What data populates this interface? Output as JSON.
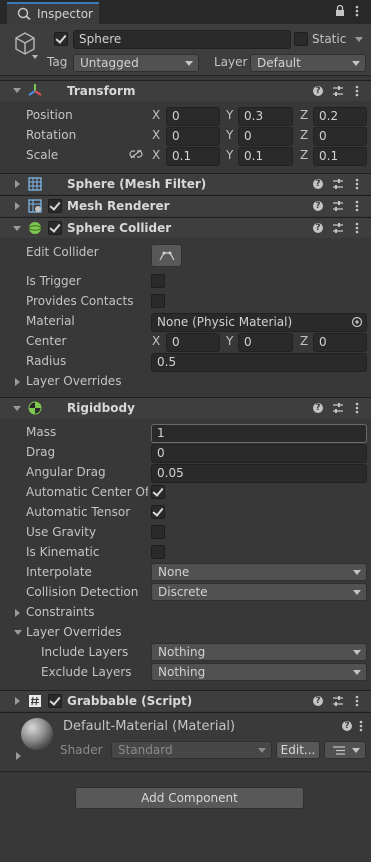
{
  "tab": {
    "title": "Inspector"
  },
  "object": {
    "name": "Sphere",
    "static_label": "Static",
    "tag_label": "Tag",
    "tag_value": "Untagged",
    "layer_label": "Layer",
    "layer_value": "Default",
    "active": true,
    "is_static": false
  },
  "transform": {
    "title": "Transform",
    "position": {
      "label": "Position",
      "x": "0",
      "y": "0.3",
      "z": "0.2"
    },
    "rotation": {
      "label": "Rotation",
      "x": "0",
      "y": "0",
      "z": "0"
    },
    "scale": {
      "label": "Scale",
      "x": "0.1",
      "y": "0.1",
      "z": "0.1"
    },
    "axis": {
      "x": "X",
      "y": "Y",
      "z": "Z"
    }
  },
  "mesh_filter": {
    "title": "Sphere (Mesh Filter)"
  },
  "mesh_renderer": {
    "title": "Mesh Renderer",
    "enabled": true
  },
  "sphere_collider": {
    "title": "Sphere Collider",
    "enabled": true,
    "edit_collider": "Edit Collider",
    "is_trigger": "Is Trigger",
    "provides_contacts": "Provides Contacts",
    "material": "Material",
    "material_value": "None (Physic Material)",
    "center": "Center",
    "center_x": "0",
    "center_y": "0",
    "center_z": "0",
    "radius": "Radius",
    "radius_value": "0.5",
    "layer_overrides": "Layer Overrides"
  },
  "rigidbody": {
    "title": "Rigidbody",
    "mass": "Mass",
    "mass_value": "1",
    "drag": "Drag",
    "drag_value": "0",
    "angular_drag": "Angular Drag",
    "angular_drag_value": "0.05",
    "auto_center": "Automatic Center Of M",
    "auto_center_checked": true,
    "auto_tensor": "Automatic Tensor",
    "auto_tensor_checked": true,
    "use_gravity": "Use Gravity",
    "is_kinematic": "Is Kinematic",
    "interpolate": "Interpolate",
    "interpolate_value": "None",
    "collision": "Collision Detection",
    "collision_value": "Discrete",
    "constraints": "Constraints",
    "layer_overrides": "Layer Overrides",
    "include_layers": "Include Layers",
    "include_value": "Nothing",
    "exclude_layers": "Exclude Layers",
    "exclude_value": "Nothing"
  },
  "grabbable": {
    "title": "Grabbable (Script)",
    "enabled": true
  },
  "material": {
    "name": "Default-Material (Material)",
    "shader_label": "Shader",
    "shader_value": "Standard",
    "edit_label": "Edit...",
    "help": "?"
  },
  "add_component": "Add Component",
  "help_glyph": "?",
  "colors": {
    "accent": "#3a79bb",
    "panel": "#383838",
    "header": "#3e3e3e",
    "field": "#2a2a2a"
  }
}
